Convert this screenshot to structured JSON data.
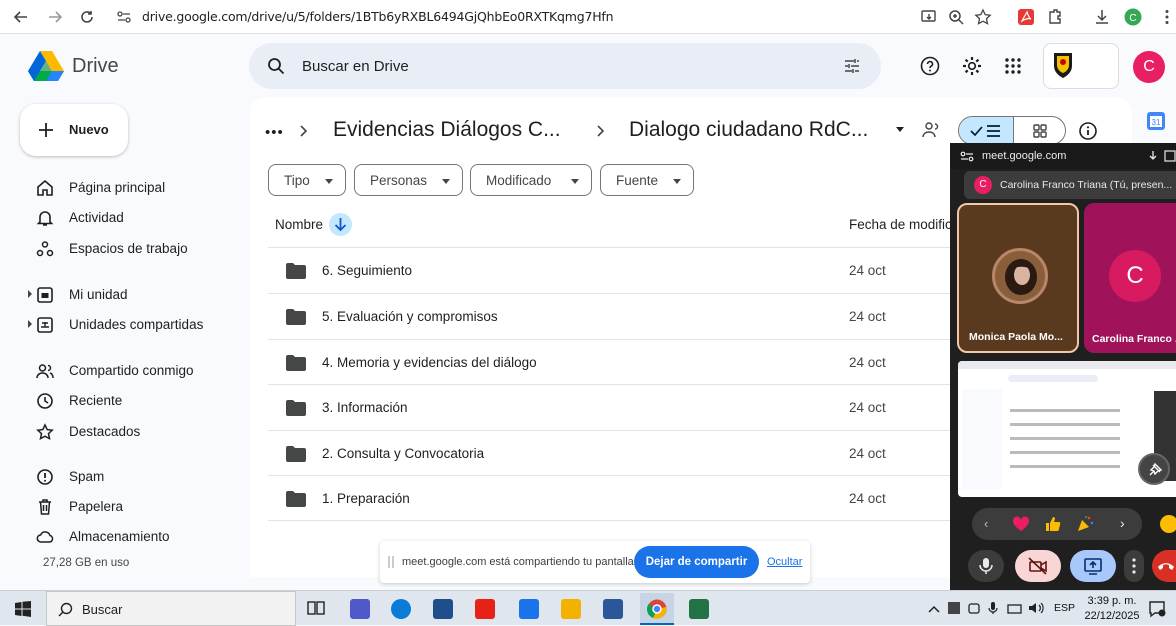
{
  "browser": {
    "url": "drive.google.com/drive/u/5/folders/1BTb6yRXBL6494GjQhbEo0RXTKqmg7Hfn"
  },
  "drive": {
    "app_name": "Drive",
    "search_placeholder": "Buscar en Drive",
    "avatar_letter": "C",
    "new_button_label": "Nuevo"
  },
  "sidebar": {
    "items": [
      {
        "label": "Página principal",
        "icon": "home-icon"
      },
      {
        "label": "Actividad",
        "icon": "bell-icon"
      },
      {
        "label": "Espacios de trabajo",
        "icon": "workspaces-icon"
      },
      {
        "label": "Mi unidad",
        "icon": "drive-icon"
      },
      {
        "label": "Unidades compartidas",
        "icon": "shared-drives-icon"
      },
      {
        "label": "Compartido conmigo",
        "icon": "people-icon"
      },
      {
        "label": "Reciente",
        "icon": "clock-icon"
      },
      {
        "label": "Destacados",
        "icon": "star-icon"
      },
      {
        "label": "Spam",
        "icon": "spam-icon"
      },
      {
        "label": "Papelera",
        "icon": "trash-icon"
      },
      {
        "label": "Almacenamiento",
        "icon": "cloud-icon"
      }
    ],
    "storage_used": "27,28 GB en uso"
  },
  "breadcrumb": {
    "ellipsis": "•••",
    "parent": "Evidencias Diálogos C...",
    "current": "Dialogo ciudadano RdC..."
  },
  "filters": [
    "Tipo",
    "Personas",
    "Modificado",
    "Fuente"
  ],
  "columns": {
    "name": "Nombre",
    "date": "Fecha de modific"
  },
  "files": [
    {
      "name": "6. Seguimiento",
      "date": "24 oct"
    },
    {
      "name": "5. Evaluación y compromisos",
      "date": "24 oct"
    },
    {
      "name": "4. Memoria y evidencias del diálogo",
      "date": "24 oct"
    },
    {
      "name": "3. Información",
      "date": "24 oct"
    },
    {
      "name": "2. Consulta y Convocatoria",
      "date": "24 oct"
    },
    {
      "name": "1. Preparación",
      "date": "24 oct"
    }
  ],
  "meet": {
    "url": "meet.google.com",
    "presenter": "Carolina Franco Triana (Tú, presen...",
    "presenter_initial": "C",
    "participants": [
      {
        "name": "Monica Paola Mo..."
      },
      {
        "name": "Carolina Franco ...",
        "initial": "C"
      }
    ]
  },
  "share_bar": {
    "message": "meet.google.com está compartiendo tu pantalla.",
    "stop_label": "Dejar de compartir",
    "hide_label": "Ocultar"
  },
  "taskbar": {
    "search_label": "Buscar",
    "lang": "ESP",
    "time": "3:39 p. m.",
    "date": "22/12/2025"
  },
  "colors": {
    "accent_blue": "#1a73e8",
    "avatar_pink": "#e91e63",
    "meet_tile_pink": "#a0135a",
    "meet_tile_brown": "#5a3a1e",
    "stop_camera_red": "#f9d6d5",
    "end_call_red": "#d93025"
  }
}
